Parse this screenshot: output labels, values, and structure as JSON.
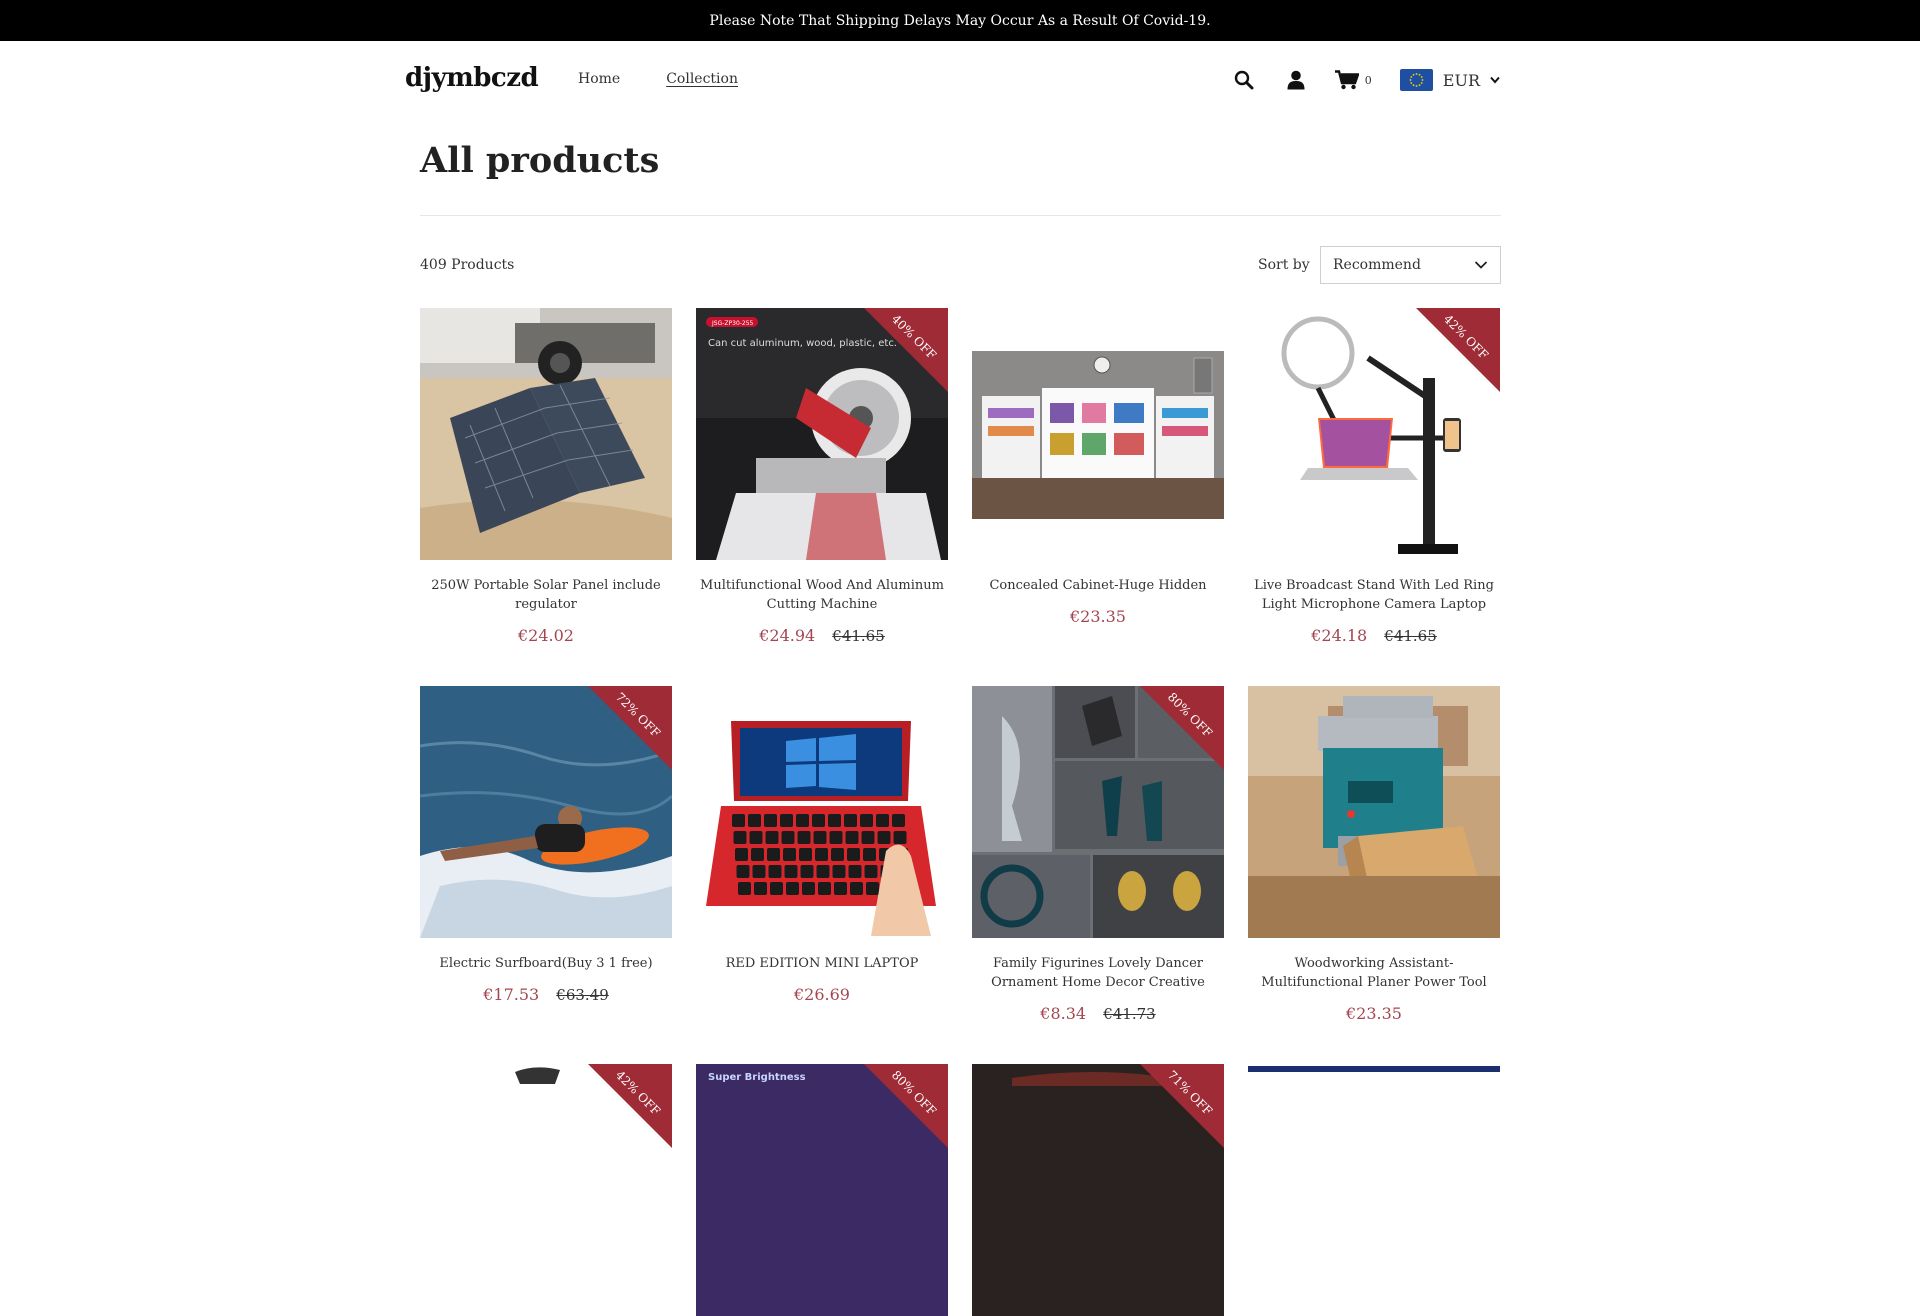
{
  "announcement": "Please Note That Shipping Delays May Occur As a Result Of Covid-19.",
  "header": {
    "logo": "djymbczd",
    "nav": [
      "Home",
      "Collection"
    ],
    "cart_count": "0",
    "currency": "EUR"
  },
  "page": {
    "title": "All products",
    "count": "409 Products",
    "sort_label": "Sort by",
    "sort_value": "Recommend"
  },
  "products": [
    {
      "title": "250W Portable Solar Panel include regulator",
      "price": "€24.02",
      "old": "",
      "badge": ""
    },
    {
      "title": "Multifunctional Wood And Aluminum Cutting Machine",
      "price": "€24.94",
      "old": "€41.65",
      "badge": "40% OFF",
      "img_text": "Can cut aluminum, wood, plastic, etc.",
      "img_tag": "JSG-ZP30-255"
    },
    {
      "title": "Concealed Cabinet-Huge Hidden Space",
      "price": "€23.35",
      "old": "",
      "badge": ""
    },
    {
      "title": "Live Broadcast Stand With Led Ring Light Microphone Camera Laptop Stand",
      "price": "€24.18",
      "old": "€41.65",
      "badge": "42% OFF"
    },
    {
      "title": "Electric Surfboard(Buy 3 1 free)",
      "price": "€17.53",
      "old": "€63.49",
      "badge": "72% OFF"
    },
    {
      "title": "RED EDITION MINI LAPTOP",
      "price": "€26.69",
      "old": "",
      "badge": ""
    },
    {
      "title": "Family Figurines Lovely Dancer Ornament Home Decor Creative Anima..",
      "price": "€8.34",
      "old": "€41.73",
      "badge": "80% OFF"
    },
    {
      "title": "Woodworking Assistant-Multifunctional Planer Power Tool",
      "price": "€23.35",
      "old": "",
      "badge": ""
    },
    {
      "badge": "42% OFF"
    },
    {
      "badge": "80% OFF",
      "img_text": "Super Brightness"
    },
    {
      "badge": "71% OFF"
    },
    {
      "badge": ""
    }
  ],
  "colors": {
    "accent": "#a34650",
    "ribbon": "#9e2b35",
    "topbar": "#000000"
  }
}
